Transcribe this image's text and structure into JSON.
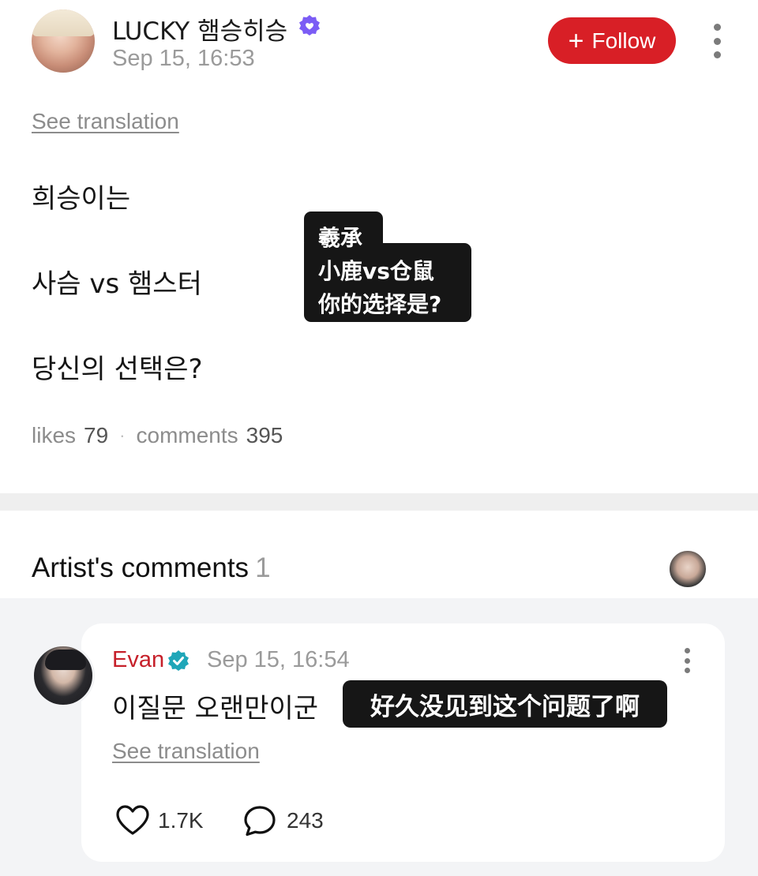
{
  "post": {
    "author_name": "LUCKY 햄승히승",
    "timestamp": "Sep 15, 16:53",
    "follow_label": "Follow",
    "see_translation": "See translation",
    "lines": [
      "희승이는",
      "사슴 vs 햄스터",
      "당신의 선택은?"
    ],
    "overlay_lines": [
      "羲承",
      "小鹿vs仓鼠",
      "你的选择是?"
    ],
    "likes_label": "likes",
    "likes_count": "79",
    "comments_label": "comments",
    "comments_count": "395"
  },
  "artist_comments": {
    "title": "Artist's comments",
    "count": "1"
  },
  "comment": {
    "author_name": "Evan",
    "timestamp": "Sep 15, 16:54",
    "text": "이질문 오랜만이군",
    "overlay_text": "好久没见到这个问题了啊",
    "see_translation": "See translation",
    "like_count": "1.7K",
    "reply_count": "243"
  },
  "colors": {
    "follow_red": "#d81f26",
    "name_red": "#c6202a",
    "badge_purple": "#7b5cf5",
    "badge_teal": "#1fa6b8"
  },
  "icons": [
    "verified-badge",
    "plus-icon",
    "more-vertical-icon",
    "heart-outline-icon",
    "speech-bubble-outline-icon"
  ]
}
